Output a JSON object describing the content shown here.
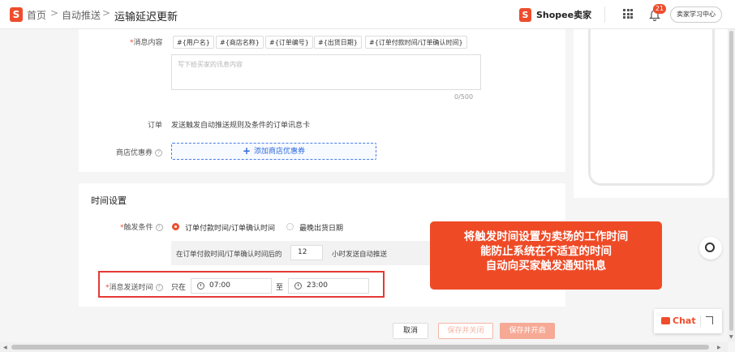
{
  "header": {
    "breadcrumb": [
      "首页",
      "自动推送",
      "运输延迟更新"
    ],
    "separator": ">",
    "logo_letter": "S",
    "brand": "Shopee卖家",
    "notification_count": "21",
    "learning_center": "卖家学习中心"
  },
  "message": {
    "label": "消息内容",
    "required_mark": "*",
    "tags": [
      "#{用户名}",
      "#{商店名称}",
      "#{订单编号}",
      "#{出货日期}",
      "#{订单付款时间/订单确认时间}"
    ],
    "placeholder": "写下给买家的讯息内容",
    "counter": "0/500"
  },
  "order": {
    "label": "订单",
    "value": "发送触发自动推送规则及条件的订单讯息卡"
  },
  "coupon": {
    "label": "商店优惠券",
    "help": "?",
    "button_plus": "+",
    "button": "添加商店优惠券"
  },
  "time_settings": {
    "title": "时间设置",
    "trigger_label": "触发条件",
    "options": [
      "订单付款时间/订单确认时间",
      "最晚出货日期"
    ],
    "selected_index": 0,
    "after_text": "在订单付款时间/订单确认时间后的",
    "hours": "12",
    "hours_suffix": "小时发送自动推送",
    "send_time_label": "消息发送时间",
    "only": "只在",
    "start_time": "07:00",
    "to": "至",
    "end_time": "23:00"
  },
  "callout": {
    "lines": [
      "将触发时间设置为卖场的工作时间",
      "能防止系统在不适宜的时间",
      "自动向买家触发通知讯息"
    ]
  },
  "footer": {
    "cancel": "取消",
    "save_close": "保存并关闭",
    "save_open": "保存并开启"
  },
  "chat": {
    "label": "Chat"
  },
  "colors": {
    "accent": "#ee4d2d",
    "highlight_frame": "#e53935",
    "link": "#2f6bdc"
  }
}
